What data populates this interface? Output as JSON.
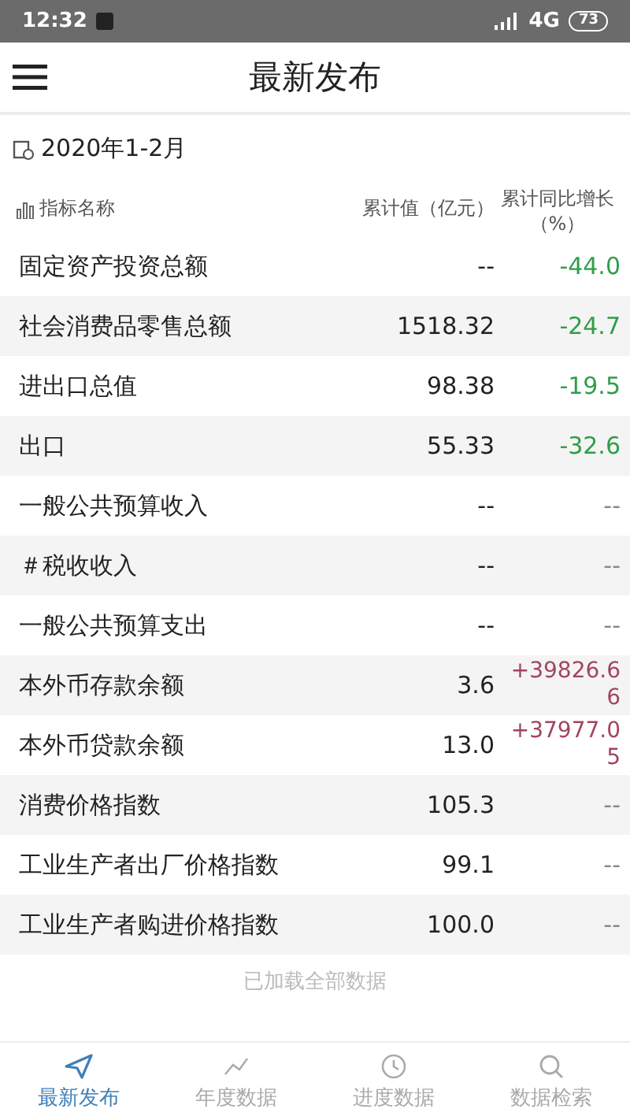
{
  "status_bar": {
    "time": "12:32",
    "network": "4G",
    "battery": "73"
  },
  "app_bar": {
    "title": "最新发布"
  },
  "period": "2020年1-2月",
  "table": {
    "columns": [
      "指标名称",
      "累计值（亿元）",
      "累计同比增长（%）"
    ],
    "rows": [
      {
        "name": "固定资产投资总额",
        "value": "--",
        "change": "-44.0",
        "color": "#2f9e4a"
      },
      {
        "name": "社会消费品零售总额",
        "value": "1518.32",
        "change": "-24.7",
        "color": "#2f9e4a"
      },
      {
        "name": "进出口总值",
        "value": "98.38",
        "change": "-19.5",
        "color": "#2f9e4a"
      },
      {
        "name": "出口",
        "value": "55.33",
        "change": "-32.6",
        "color": "#2f9e4a"
      },
      {
        "name": "一般公共预算收入",
        "value": "--",
        "change": "--",
        "color": "#888888"
      },
      {
        "name": "＃税收收入",
        "value": "--",
        "change": "--",
        "color": "#888888"
      },
      {
        "name": "一般公共预算支出",
        "value": "--",
        "change": "--",
        "color": "#888888"
      },
      {
        "name": "本外币存款余额",
        "value": "3.6",
        "change": "+39826.66",
        "color": "#a2455d"
      },
      {
        "name": "本外币贷款余额",
        "value": "13.0",
        "change": "+37977.05",
        "color": "#a2455d"
      },
      {
        "name": "消费价格指数",
        "value": "105.3",
        "change": "--",
        "color": "#888888"
      },
      {
        "name": "工业生产者出厂价格指数",
        "value": "99.1",
        "change": "--",
        "color": "#888888"
      },
      {
        "name": "工业生产者购进价格指数",
        "value": "100.0",
        "change": "--",
        "color": "#888888"
      }
    ]
  },
  "footer_note": "已加载全部数据",
  "bottom_nav": [
    {
      "label": "最新发布",
      "kind": "send",
      "selected": true
    },
    {
      "label": "年度数据",
      "kind": "line",
      "selected": false
    },
    {
      "label": "进度数据",
      "kind": "clock",
      "selected": false
    },
    {
      "label": "数据检索",
      "kind": "search",
      "selected": false
    }
  ]
}
